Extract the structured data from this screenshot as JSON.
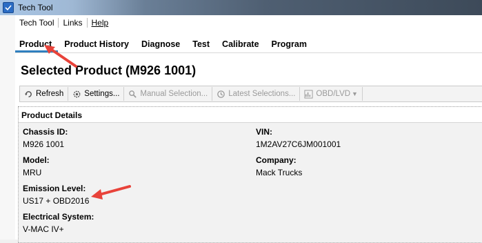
{
  "window": {
    "title": "Tech Tool"
  },
  "menu": {
    "items": [
      "Tech Tool",
      "Links",
      "Help"
    ]
  },
  "tabs": [
    "Product",
    "Product History",
    "Diagnose",
    "Test",
    "Calibrate",
    "Program"
  ],
  "page": {
    "title": "Selected Product (M926 1001)"
  },
  "toolbar": {
    "refresh": "Refresh",
    "settings": "Settings...",
    "manual": "Manual Selection...",
    "latest": "Latest Selections...",
    "obd": "OBD/LVD"
  },
  "details": {
    "header": "Product Details",
    "chassis_label": "Chassis ID:",
    "chassis_value": "M926 1001",
    "vin_label": "VIN:",
    "vin_value": "1M2AV27C6JM001001",
    "model_label": "Model:",
    "model_value": "MRU",
    "company_label": "Company:",
    "company_value": "Mack Trucks",
    "emission_label": "Emission Level:",
    "emission_value": "US17 + OBD2016",
    "electrical_label": "Electrical System:",
    "electrical_value": "V-MAC IV+"
  },
  "colors": {
    "active_tab": "#2f7fbf",
    "arrow": "#e8433a"
  }
}
